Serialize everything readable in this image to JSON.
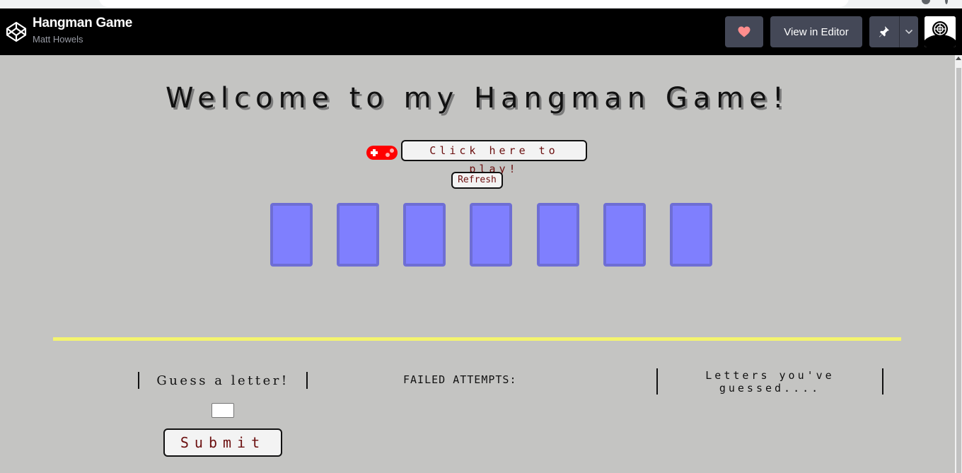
{
  "header": {
    "title": "Hangman Game",
    "author": "Matt Howels",
    "view_in_editor_label": "View in Editor",
    "heart_icon": "heart-icon",
    "pin_icon": "pin-icon",
    "logo_icon": "codepen-logo-icon"
  },
  "game": {
    "welcome": "Welcome to my Hangman Game!",
    "play_label": "Click here to play!",
    "refresh_label": "Refresh",
    "letter_slots": [
      "",
      "",
      "",
      "",
      "",
      "",
      ""
    ],
    "guess_label": "Guess a letter!",
    "guess_value": "",
    "submit_label": "Submit",
    "failed_label": "FAILED ATTEMPTS:",
    "guessed_label": "Letters you've guessed...."
  },
  "colors": {
    "header_bg": "#000000",
    "page_bg": "#c4c4c2",
    "letter_box": "#7f7ffe",
    "divider": "#f4f46e",
    "button_text": "#6b0f0f",
    "heart": "#ff8d8d"
  }
}
